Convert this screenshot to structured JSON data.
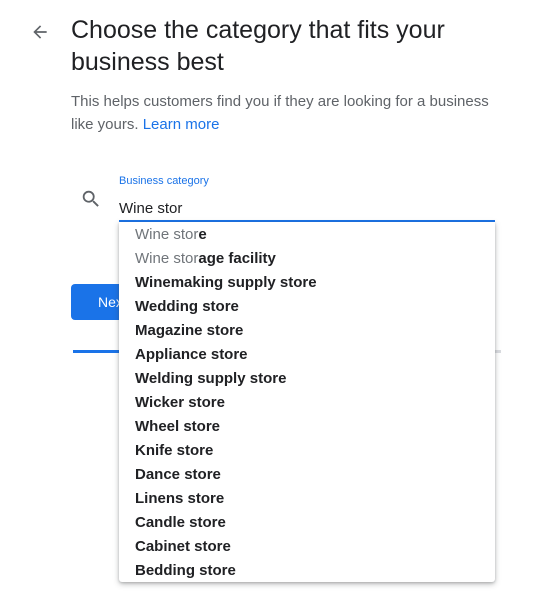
{
  "header": {
    "title": "Choose the category that fits your business best",
    "subtitle": "This helps customers find you if they are looking for a business like yours.",
    "learn_more": "Learn more"
  },
  "category_field": {
    "label": "Business category",
    "value": "Wine stor"
  },
  "next_button": {
    "label": "Next"
  },
  "progress": {
    "fraction": 0.14
  },
  "suggestions": [
    {
      "match": "Wine stor",
      "rest": "e"
    },
    {
      "match": "Wine stor",
      "rest": "age facility"
    },
    {
      "match": "",
      "rest": "Winemaking supply store"
    },
    {
      "match": "",
      "rest": "Wedding store"
    },
    {
      "match": "",
      "rest": "Magazine store"
    },
    {
      "match": "",
      "rest": "Appliance store"
    },
    {
      "match": "",
      "rest": "Welding supply store"
    },
    {
      "match": "",
      "rest": "Wicker store"
    },
    {
      "match": "",
      "rest": "Wheel store"
    },
    {
      "match": "",
      "rest": "Knife store"
    },
    {
      "match": "",
      "rest": "Dance store"
    },
    {
      "match": "",
      "rest": "Linens store"
    },
    {
      "match": "",
      "rest": "Candle store"
    },
    {
      "match": "",
      "rest": "Cabinet store"
    },
    {
      "match": "",
      "rest": "Bedding store"
    }
  ],
  "colors": {
    "accent": "#1a73e8",
    "text_primary": "#202124",
    "text_secondary": "#5f6368",
    "match_text": "#70757a"
  },
  "icons": {
    "back": "arrow-back-icon",
    "search": "search-icon"
  }
}
